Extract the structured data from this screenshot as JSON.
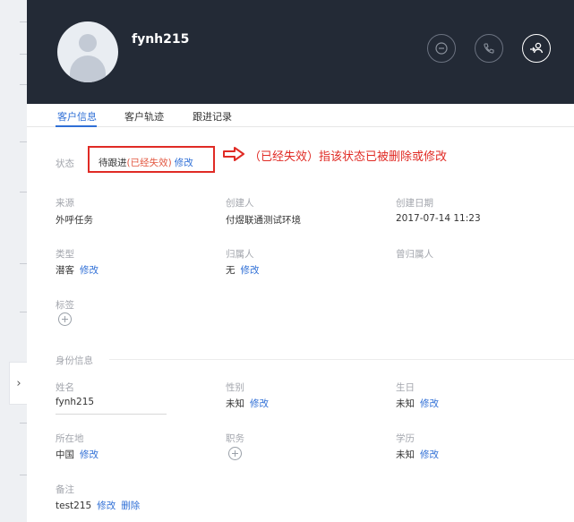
{
  "header": {
    "username": "fynh215"
  },
  "tabs": [
    "客户信息",
    "客户轨迹",
    "跟进记录"
  ],
  "status": {
    "label": "状态",
    "value": "待跟进",
    "expired": "(已经失效)",
    "edit": "修改"
  },
  "annotation": "（已经失效）指该状态已被删除或修改",
  "fields": {
    "source": {
      "label": "来源",
      "value": "外呼任务"
    },
    "creator": {
      "label": "创建人",
      "value": "付煜联通测试环境"
    },
    "created_date": {
      "label": "创建日期",
      "value": "2017-07-14 11:23"
    },
    "type": {
      "label": "类型",
      "value": "潜客",
      "edit": "修改"
    },
    "owner": {
      "label": "归属人",
      "value": "无",
      "edit": "修改"
    },
    "former_owner": {
      "label": "曾归属人"
    },
    "tags": {
      "label": "标签"
    }
  },
  "identity_section": "身份信息",
  "identity": {
    "name": {
      "label": "姓名",
      "value": "fynh215"
    },
    "gender": {
      "label": "性别",
      "value": "未知",
      "edit": "修改"
    },
    "birthday": {
      "label": "生日",
      "value": "未知",
      "edit": "修改"
    },
    "location": {
      "label": "所在地",
      "value": "中国",
      "edit": "修改"
    },
    "position": {
      "label": "职务"
    },
    "education": {
      "label": "学历",
      "value": "未知",
      "edit": "修改"
    },
    "remark": {
      "label": "备注",
      "value": "test215",
      "edit": "修改",
      "delete": "删除"
    }
  },
  "colors": {
    "header_bg": "#232a36",
    "link": "#2f6fd6",
    "annotation_red": "#e02b25",
    "expired": "#e2563f"
  },
  "icons": [
    "user-avatar-icon",
    "message-icon",
    "phone-icon",
    "transfer-user-icon",
    "plus-icon",
    "chevron-right-icon",
    "arrow-right-icon"
  ]
}
